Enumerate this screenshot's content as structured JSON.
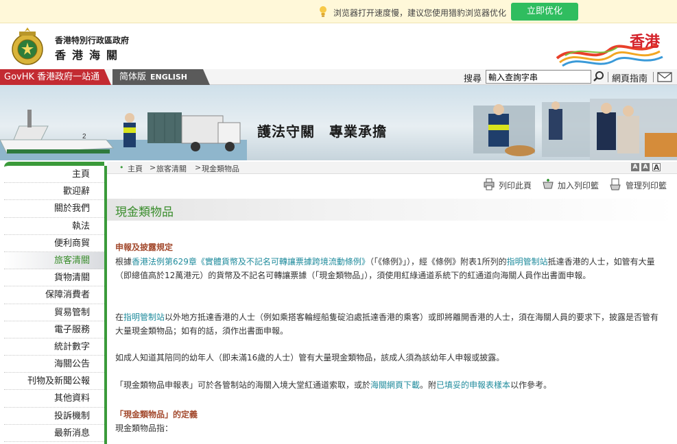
{
  "notice": {
    "message": "浏览器打开速度慢，建议您使用猎豹浏览器优化",
    "button_label": "立即优化"
  },
  "header": {
    "org_line1": "香港特別行政區政府",
    "org_line2": "香港海關",
    "brand_text": "香港"
  },
  "navbar": {
    "govhk_label": "GovHK 香港政府一站通",
    "simplified_label": "简体版",
    "english_label": "ENGLISH",
    "search_label": "搜尋",
    "search_value": "輸入查詢字串",
    "sitemap_label": "網頁指南"
  },
  "banner": {
    "slogan": "護法守關　專業承擔"
  },
  "sidebar": {
    "items": [
      {
        "label": "主頁"
      },
      {
        "label": "歡迎辭"
      },
      {
        "label": "關於我們"
      },
      {
        "label": "執法"
      },
      {
        "label": "便利商貿"
      },
      {
        "label": "旅客清關"
      },
      {
        "label": "貨物清關"
      },
      {
        "label": "保障消費者"
      },
      {
        "label": "貿易管制"
      },
      {
        "label": "電子服務"
      },
      {
        "label": "統計數字"
      },
      {
        "label": "海關公告"
      },
      {
        "label": "刊物及新聞公報"
      },
      {
        "label": "其他資料"
      },
      {
        "label": "投訴機制"
      },
      {
        "label": "最新消息"
      }
    ],
    "active_index": 5
  },
  "breadcrumb": {
    "home": "主頁",
    "level1": "旅客清關",
    "level2": "現金類物品"
  },
  "font_size": {
    "small": "A",
    "medium": "A",
    "large": "A"
  },
  "toolbar": {
    "print_label": "列印此頁",
    "add_label": "加入列印籃",
    "manage_label": "管理列印籃"
  },
  "page": {
    "title": "現金類物品",
    "section1_head": "申報及披露規定",
    "p1_pre": "根據",
    "p1_link1": "香港法例第629章《實體貨幣及不記名可轉讓票據跨境流動條例》",
    "p1_mid": "（「《條例》」），經《條例》附表1所列的",
    "p1_link2": "指明管制站",
    "p1_post": "抵達香港的人士，如管有大量（即總值高於12萬港元）的貨幣及不記名可轉讓票據（「現金類物品」），須使用紅綠通道系統下的紅通道向海關人員作出書面申報。",
    "p2_pre": "在",
    "p2_link": "指明管制站",
    "p2_post": "以外地方抵達香港的人士（例如乘搭客輪經船隻碇泊處抵達香港的乘客）或即將離開香港的人士，須在海關人員的要求下，披露是否管有大量現金類物品；如有的話，須作出書面申報。",
    "p3": "如成人知道其陪同的幼年人（即未滿16歲的人士）管有大量現金類物品，該成人須為該幼年人申報或披露。",
    "p4_pre": "「現金類物品申報表」可於各管制站的海關入境大堂紅通道索取，或於",
    "p4_link1": "海關網頁下載",
    "p4_mid": "。附",
    "p4_link2": "已填妥的申報表樣本",
    "p4_post": "以作參考。",
    "section2_head": "「現金類物品」的定義",
    "p5": "現金類物品指："
  }
}
